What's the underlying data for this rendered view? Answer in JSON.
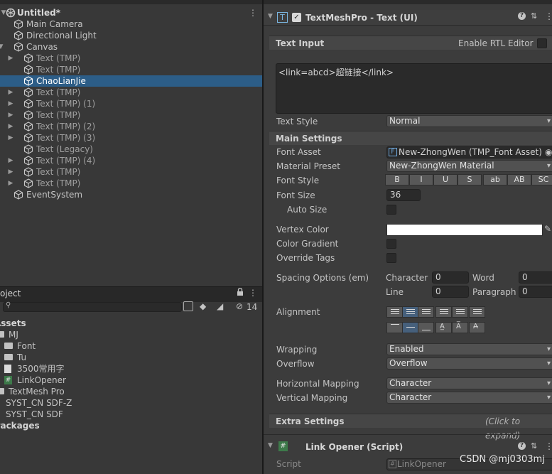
{
  "hierarchy": {
    "scene": "Untitled*",
    "items": [
      {
        "label": "Main Camera",
        "indent": 1,
        "arrow": false,
        "selected": false,
        "dim": false
      },
      {
        "label": "Directional Light",
        "indent": 1,
        "arrow": false,
        "selected": false,
        "dim": false
      },
      {
        "label": "Canvas",
        "indent": 1,
        "arrow": true,
        "selected": false,
        "dim": false
      },
      {
        "label": "Text (TMP)",
        "indent": 2,
        "arrow": true,
        "selected": false,
        "dim": true
      },
      {
        "label": "Text (TMP)",
        "indent": 2,
        "arrow": false,
        "selected": false,
        "dim": true
      },
      {
        "label": "ChaoLianJie",
        "indent": 2,
        "arrow": false,
        "selected": true,
        "dim": false
      },
      {
        "label": "Text (TMP)",
        "indent": 2,
        "arrow": true,
        "selected": false,
        "dim": true
      },
      {
        "label": "Text (TMP) (1)",
        "indent": 2,
        "arrow": true,
        "selected": false,
        "dim": true
      },
      {
        "label": "Text (TMP)",
        "indent": 2,
        "arrow": true,
        "selected": false,
        "dim": true
      },
      {
        "label": "Text (TMP) (2)",
        "indent": 2,
        "arrow": true,
        "selected": false,
        "dim": true
      },
      {
        "label": "Text (TMP) (3)",
        "indent": 2,
        "arrow": true,
        "selected": false,
        "dim": true
      },
      {
        "label": "Text (Legacy)",
        "indent": 2,
        "arrow": false,
        "selected": false,
        "dim": true
      },
      {
        "label": "Text (TMP) (4)",
        "indent": 2,
        "arrow": true,
        "selected": false,
        "dim": true
      },
      {
        "label": "Text (TMP)",
        "indent": 2,
        "arrow": true,
        "selected": false,
        "dim": true
      },
      {
        "label": "Text (TMP)",
        "indent": 2,
        "arrow": true,
        "selected": false,
        "dim": true
      },
      {
        "label": "EventSystem",
        "indent": 1,
        "arrow": false,
        "selected": false,
        "dim": false
      }
    ]
  },
  "project": {
    "tab": "oject",
    "hidden_count": "14",
    "items": [
      {
        "label": "Assets",
        "kind": "root"
      },
      {
        "label": "MJ",
        "kind": "folder1"
      },
      {
        "label": "Font",
        "kind": "folder2"
      },
      {
        "label": "Tu",
        "kind": "folder2"
      },
      {
        "label": "3500常用字",
        "kind": "file2"
      },
      {
        "label": "LinkOpener",
        "kind": "script2"
      },
      {
        "label": "TextMesh Pro",
        "kind": "folder1"
      },
      {
        "label": "SYST_CN SDF-Z",
        "kind": "font1"
      },
      {
        "label": "SYST_CN SDF",
        "kind": "font1"
      },
      {
        "label": "Packages",
        "kind": "root"
      }
    ]
  },
  "inspector": {
    "component_title": "TextMeshPro - Text (UI)",
    "text_input_header": "Text Input",
    "rtl_label": "Enable RTL Editor",
    "text_value": "<link=abcd>超链接</link>",
    "text_style_label": "Text Style",
    "text_style_value": "Normal",
    "main_settings_header": "Main Settings",
    "font_asset_label": "Font Asset",
    "font_asset_value": "New-ZhongWen (TMP_Font Asset)",
    "material_preset_label": "Material Preset",
    "material_preset_value": "New-ZhongWen Material",
    "font_style_label": "Font Style",
    "font_style_buttons": [
      "B",
      "I",
      "U",
      "S",
      "ab",
      "AB",
      "SC"
    ],
    "font_size_label": "Font Size",
    "font_size_value": "36",
    "auto_size_label": "Auto Size",
    "vertex_color_label": "Vertex Color",
    "color_gradient_label": "Color Gradient",
    "override_tags_label": "Override Tags",
    "spacing_label": "Spacing Options (em)",
    "character_label": "Character",
    "character_value": "0",
    "word_label": "Word",
    "word_value": "0",
    "line_label": "Line",
    "line_value": "0",
    "paragraph_label": "Paragraph",
    "paragraph_value": "0",
    "alignment_label": "Alignment",
    "wrapping_label": "Wrapping",
    "wrapping_value": "Enabled",
    "overflow_label": "Overflow",
    "overflow_value": "Overflow",
    "hmapping_label": "Horizontal Mapping",
    "hmapping_value": "Character",
    "vmapping_label": "Vertical Mapping",
    "vmapping_value": "Character",
    "extra_settings_header": "Extra Settings",
    "extra_settings_hint": "(Click to expand)",
    "script_component_title": "Link Opener (Script)",
    "script_label": "Script",
    "script_value": "LinkOpener"
  },
  "watermark": "CSDN @mj0303mj"
}
